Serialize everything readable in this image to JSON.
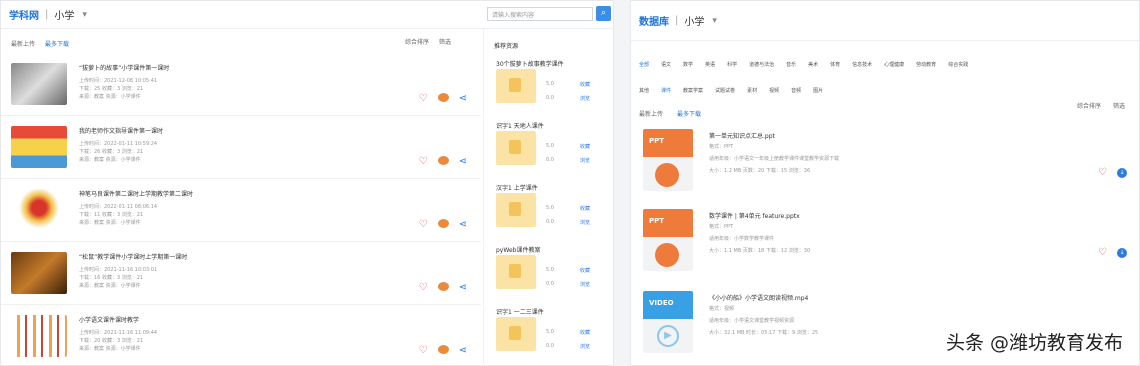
{
  "left": {
    "brand": "学科网",
    "grade": "小学",
    "search_placeholder": "请输入搜索内容",
    "tabs": [
      "最新上传",
      "最多下载"
    ],
    "sort": [
      "综合排序",
      "筛选"
    ],
    "items": [
      {
        "title": "“拔萝卜的故事”小学课件第一课时",
        "meta": [
          "上传时间：2021-12-08 10:05:41",
          "下载：25  收藏：3  浏览：21",
          "来源：教案  资源：小学课件"
        ]
      },
      {
        "title": "我的老师作文指导课件第一课时",
        "meta": [
          "上传时间：2022-01-11 10:59:24",
          "下载：26  收藏：3  浏览：21",
          "来源：教案  资源：小学课件"
        ]
      },
      {
        "title": "神笔马良课件第二课时上学期教学第二课时",
        "meta": [
          "上传时间：2022-01-11 08:06:14",
          "下载：11  收藏：3  浏览：21",
          "来源：教案  资源：小学课件"
        ]
      },
      {
        "title": "“松鼠”教学课件小学课时上学期第一课时",
        "meta": [
          "上传时间：2021-11-16 10:03:01",
          "下载：16  收藏：3  浏览：21",
          "来源：教案  资源：小学课件"
        ]
      },
      {
        "title": "小学语文课件课时教学",
        "meta": [
          "上传时间：2021-11-16 11:09:44",
          "下载：20  收藏：3  浏览：21",
          "来源：教案  资源：小学课件"
        ]
      }
    ],
    "side_title": "推荐资源",
    "side_items": [
      {
        "name": "30个拔萝卜故事教学课件",
        "v1": "5.0",
        "v2": "0.0",
        "l1": "收藏",
        "l2": "浏览"
      },
      {
        "name": "识字1 天地人课件",
        "v1": "5.0",
        "v2": "0.0",
        "l1": "收藏",
        "l2": "浏览"
      },
      {
        "name": "汉字1 上学课件",
        "v1": "5.0",
        "v2": "0.0",
        "l1": "收藏",
        "l2": "浏览"
      },
      {
        "name": "pyWeb课件教案",
        "v1": "5.0",
        "v2": "0.0",
        "l1": "收藏",
        "l2": "浏览"
      },
      {
        "name": "识字1 一二三课件",
        "v1": "5.0",
        "v2": "0.0",
        "l1": "收藏",
        "l2": "浏览"
      }
    ]
  },
  "right": {
    "brand": "数据库",
    "grade": "小学",
    "filters_row1": [
      "全部",
      "语文",
      "数学",
      "英语",
      "科学",
      "道德与法治",
      "音乐",
      "美术",
      "体育",
      "信息技术",
      "心理健康",
      "劳动教育",
      "综合实践"
    ],
    "filters_row2": [
      "其他",
      "课件",
      "教案学案",
      "试题试卷",
      "素材",
      "视频",
      "音频",
      "图片"
    ],
    "tabs": [
      "最新上传",
      "最多下载"
    ],
    "sort": [
      "综合排序",
      "筛选"
    ],
    "items": [
      {
        "tag": "PPT",
        "title": "第一单元知识点汇总.ppt",
        "lines": [
          "格式：PPT",
          "适用年级：小学语文一年级上册教学课件课堂教学资源下载",
          "大小：1.2 MB  页数：20  下载：15  浏览：36"
        ]
      },
      {
        "tag": "PPT",
        "title": "数学课件 | 第4单元 feature.pptx",
        "lines": [
          "格式：PPT",
          "适用年级：小学数学教学课件",
          "大小：1.1 MB  页数：18  下载：12  浏览：30"
        ]
      },
      {
        "tag": "VIDEO",
        "title": "《小小的船》小学语文朗读视频.mp4",
        "lines": [
          "格式：视频",
          "适用年级：小学语文课堂教学视频资源",
          "大小：32.1 MB  时长：05:17  下载：9  浏览：25"
        ]
      }
    ],
    "watermark": "头条 @潍坊教育发布"
  },
  "colors": {
    "accent": "#1e73d8",
    "ppt": "#ef7b3a",
    "video": "#3aa0e6",
    "heart": "#d34a4a"
  }
}
